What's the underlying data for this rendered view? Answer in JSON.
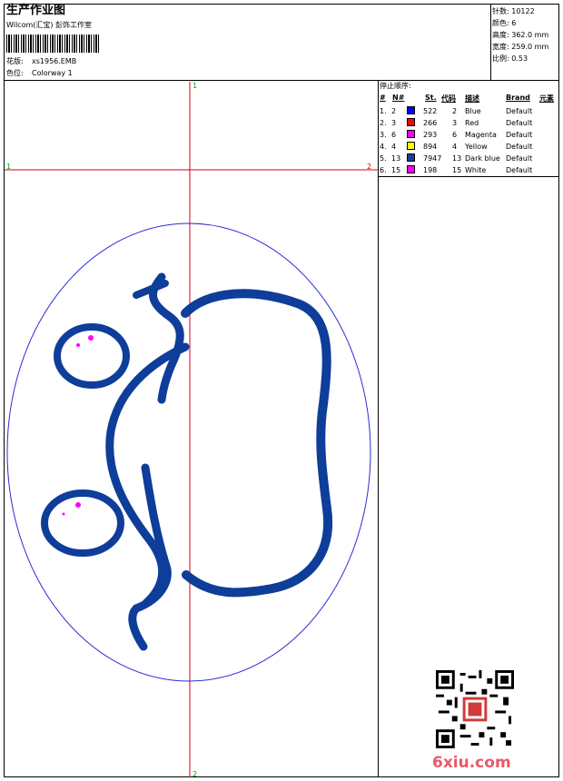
{
  "header": {
    "title": "生产作业图",
    "company": "Wilcom(汇宝) 彭饰工作室",
    "pattern_label": "花版:",
    "pattern_value": "xs1956.EMB",
    "color_label": "色位:",
    "color_value": "Colorway 1"
  },
  "info": {
    "stitches": "针数: 10122",
    "colors": "颜色: 6",
    "height": "高度: 362.0 mm",
    "width": "宽度: 259.0 mm",
    "scale": "比例: 0.53"
  },
  "stop_sequence": {
    "title": "停止顺序:",
    "headers": [
      "#",
      "N#",
      "St.",
      "代码",
      "描述",
      "Brand",
      "元素"
    ],
    "rows": [
      {
        "idx": "1.",
        "n": "2",
        "st": "522",
        "code": "2",
        "desc": "Blue",
        "brand": "Default",
        "color": "#0000ff"
      },
      {
        "idx": "2.",
        "n": "3",
        "st": "266",
        "code": "3",
        "desc": "Red",
        "brand": "Default",
        "color": "#ff0000"
      },
      {
        "idx": "3.",
        "n": "6",
        "st": "293",
        "code": "6",
        "desc": "Magenta",
        "brand": "Default",
        "color": "#ff00ff"
      },
      {
        "idx": "4.",
        "n": "4",
        "st": "894",
        "code": "4",
        "desc": "Yellow",
        "brand": "Default",
        "color": "#ffff00"
      },
      {
        "idx": "5.",
        "n": "13",
        "st": "7947",
        "code": "13",
        "desc": "Dark blue",
        "brand": "Default",
        "color": "#1a3f99"
      },
      {
        "idx": "6.",
        "n": "15",
        "st": "198",
        "code": "15",
        "desc": "White",
        "brand": "Default",
        "color": "#ff00ff"
      }
    ]
  },
  "markers": {
    "top": "1",
    "bottom": "2",
    "left": "1",
    "right": "2"
  },
  "watermark": "6xiu.com",
  "colors": {
    "design": "#0e3d9a",
    "outline": "#2b2bd6",
    "guide": "#d0001a",
    "accent": "#ff00ff"
  }
}
